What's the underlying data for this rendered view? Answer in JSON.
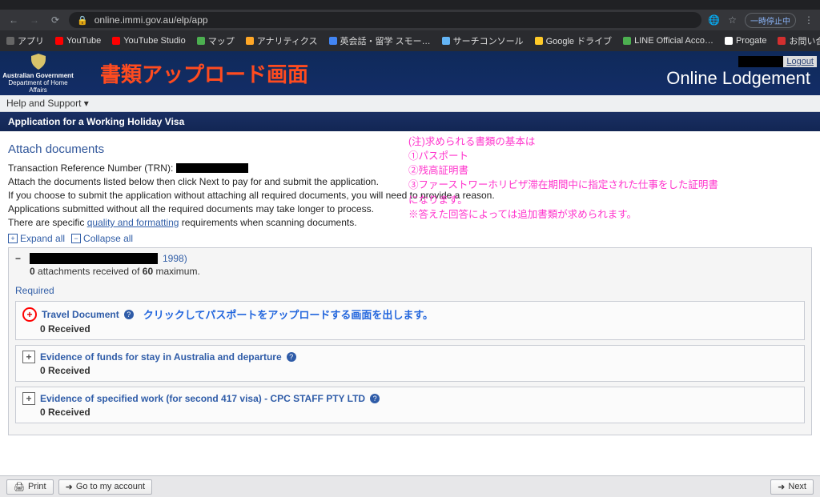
{
  "browser": {
    "url": "online.immi.gov.au/elp/app",
    "pause_chip": "一時停止中",
    "apps_label": "アプリ"
  },
  "bookmarks": [
    {
      "label": "YouTube"
    },
    {
      "label": "YouTube Studio"
    },
    {
      "label": "マップ"
    },
    {
      "label": "アナリティクス"
    },
    {
      "label": "英会話・留学 スモー…"
    },
    {
      "label": "サーチコンソール"
    },
    {
      "label": "Google ドライブ"
    },
    {
      "label": "LINE Official Acco…"
    },
    {
      "label": "Progate"
    },
    {
      "label": "お問い合わせフォーム"
    }
  ],
  "header": {
    "crest_line1": "Australian Government",
    "crest_line2": "Department of Home Affairs",
    "jp_title": "書類アップロード画面",
    "service": "Online Lodgement",
    "logout": "Logout"
  },
  "help_support": "Help and Support ▾",
  "section_title": "Application for a Working Holiday Visa",
  "attach": {
    "heading": "Attach documents",
    "trn_label": "Transaction Reference Number (TRN):",
    "p1": "Attach the documents listed below then click Next to pay for and submit the application.",
    "p2": "If you choose to submit the application without attaching all required documents, you will need to provide a reason.",
    "p3": "Applications submitted without all the required documents may take longer to process.",
    "p4a": "There are specific ",
    "p4_link": "quality and formatting",
    "p4b": " requirements when scanning documents."
  },
  "tools": {
    "expand": "Expand all",
    "collapse": "Collapse all"
  },
  "applicant": {
    "year": "1998)",
    "att_pre": "0",
    "att_mid": " attachments received of ",
    "att_bold": "60",
    "att_post": " maximum."
  },
  "required_label": "Required",
  "docs": [
    {
      "title": "Travel Document",
      "received": "0 Received"
    },
    {
      "title": "Evidence of funds for stay in Australia and departure",
      "received": "0 Received"
    },
    {
      "title": "Evidence of specified work (for second 417 visa) - CPC STAFF PTY LTD",
      "received": "0 Received"
    }
  ],
  "doc_annot": "クリックしてパスポートをアップロードする画面を出します。",
  "pink_note": {
    "l1": "(注)求められる書類の基本は",
    "l2": "①パスポート",
    "l3": "②残高証明書",
    "l4": "③ファーストワーホリビザ滞在期間中に指定された仕事をした証明書",
    "l5": "になります。",
    "l6": "※答えた回答によっては追加書類が求められます。"
  },
  "footer": {
    "print": "Print",
    "account": "Go to my account",
    "next": "Next"
  }
}
